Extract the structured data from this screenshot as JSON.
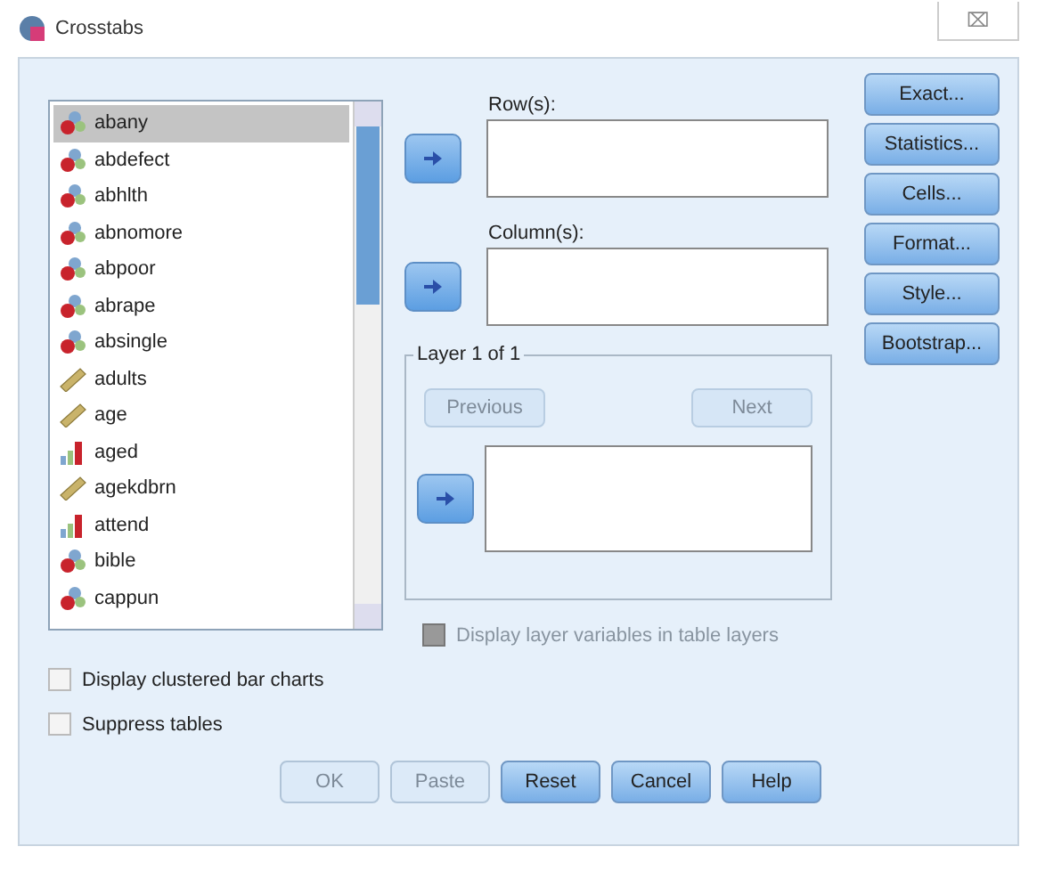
{
  "window": {
    "title": "Crosstabs",
    "close": "⌧"
  },
  "variables": [
    {
      "name": "abany",
      "kind": "nominal",
      "selected": true
    },
    {
      "name": "abdefect",
      "kind": "nominal",
      "selected": false
    },
    {
      "name": "abhlth",
      "kind": "nominal",
      "selected": false
    },
    {
      "name": "abnomore",
      "kind": "nominal",
      "selected": false
    },
    {
      "name": "abpoor",
      "kind": "nominal",
      "selected": false
    },
    {
      "name": "abrape",
      "kind": "nominal",
      "selected": false
    },
    {
      "name": "absingle",
      "kind": "nominal",
      "selected": false
    },
    {
      "name": "adults",
      "kind": "scale",
      "selected": false
    },
    {
      "name": "age",
      "kind": "scale",
      "selected": false
    },
    {
      "name": "aged",
      "kind": "ordinal",
      "selected": false
    },
    {
      "name": "agekdbrn",
      "kind": "scale",
      "selected": false
    },
    {
      "name": "attend",
      "kind": "ordinal",
      "selected": false
    },
    {
      "name": "bible",
      "kind": "nominal",
      "selected": false
    },
    {
      "name": "cappun",
      "kind": "nominal",
      "selected": false
    }
  ],
  "rows_label": "Row(s):",
  "columns_label": "Column(s):",
  "layer": {
    "title": "Layer 1 of 1",
    "previous": {
      "label": "Previous",
      "disabled": true
    },
    "next": {
      "label": "Next",
      "disabled": true
    }
  },
  "side_buttons": [
    {
      "label": "Exact..."
    },
    {
      "label": "Statistics..."
    },
    {
      "label": "Cells..."
    },
    {
      "label": "Format..."
    },
    {
      "label": "Style..."
    },
    {
      "label": "Bootstrap..."
    }
  ],
  "options": [
    {
      "label": "Display layer variables in table layers",
      "checked": false,
      "disabled": true
    },
    {
      "label": "Display clustered bar charts",
      "checked": false,
      "disabled": false
    },
    {
      "label": "Suppress tables",
      "checked": false,
      "disabled": false
    }
  ],
  "buttons": [
    {
      "label": "OK",
      "disabled": true
    },
    {
      "label": "Paste",
      "disabled": true
    },
    {
      "label": "Reset",
      "disabled": false
    },
    {
      "label": "Cancel",
      "disabled": false
    },
    {
      "label": "Help",
      "disabled": false
    }
  ]
}
